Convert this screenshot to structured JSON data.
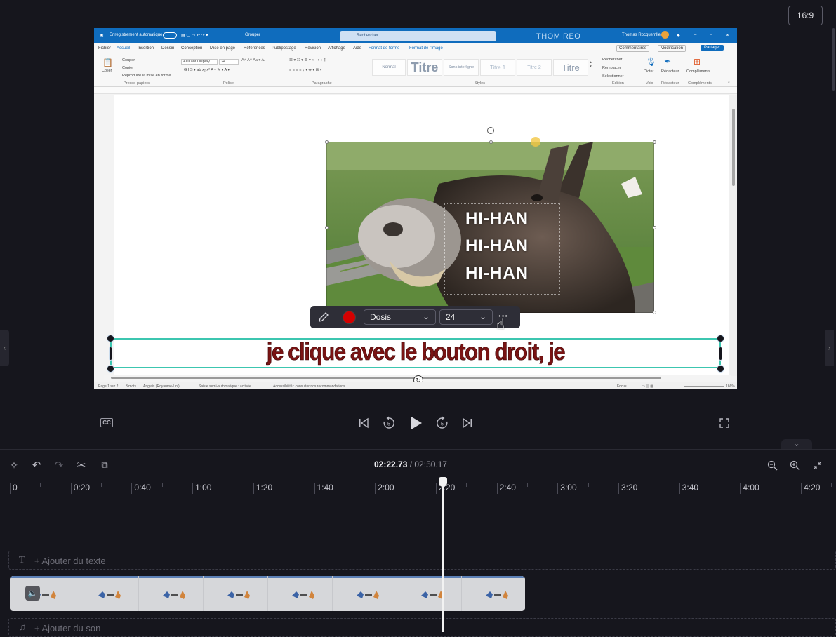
{
  "aspect_ratio": "16:9",
  "word_window": {
    "titlebar": {
      "autosave": "Enregistrement automatique",
      "group": "Grouper",
      "search_placeholder": "Rechercher",
      "watermark": "THOM REO",
      "user": "Thomas Rocquemlle"
    },
    "menu": [
      "Fichier",
      "Accueil",
      "Insertion",
      "Dessin",
      "Conception",
      "Mise en page",
      "Références",
      "Publipostage",
      "Révision",
      "Affichage",
      "Aide",
      "Format de forme",
      "Format de l'image"
    ],
    "menu_right": {
      "comments": "Commentaires",
      "modification": "Modification",
      "share": "Partager"
    },
    "ribbon": {
      "paste": "Coller",
      "cut": "Couper",
      "copy": "Copier",
      "format_painter": "Reproduire la mise en forme",
      "clipboard_group": "Presse-papiers",
      "font_name": "ADLaM Display",
      "font_size": "24",
      "font_group": "Police",
      "paragraph_group": "Paragraphe",
      "styles": [
        "Normal",
        "Titre",
        "Sans interligne",
        "Titre 1",
        "Titre 2",
        "Titre"
      ],
      "styles_group": "Styles",
      "find": "Rechercher",
      "replace": "Remplacer",
      "select": "Sélectionner",
      "edit_group": "Édition",
      "dictate": "Dicter",
      "voice_group": "Voix",
      "editor": "Rédacteur",
      "editor_group": "Rédacteur",
      "addins": "Compléments",
      "addins_group": "Compléments"
    },
    "image_text": [
      "HI-HAN",
      "HI-HAN",
      "HI-HAN"
    ],
    "statusbar": {
      "page": "Page 1 sur 2",
      "words": "3 mots",
      "language": "Anglais (Royaume-Uni)",
      "prediction": "Saisie semi-automatique : activée",
      "accessibility": "Accessibilité : consulter nos recommandations",
      "focus": "Focus",
      "zoom": "166%"
    }
  },
  "text_toolbar": {
    "color": "#d40000",
    "font": "Dosis",
    "size": "24",
    "more": "···"
  },
  "caption": "je clique avec le bouton droit, je",
  "player": {
    "cc": "CC",
    "current_time": "02:22.73",
    "total_time": "/ 02:50.17"
  },
  "timeline": {
    "ruler": [
      "0",
      "0:20",
      "0:40",
      "1:00",
      "1:20",
      "1:40",
      "2:00",
      "2:20",
      "2:40",
      "3:00",
      "3:20",
      "3:40",
      "4:00",
      "4:20"
    ],
    "add_text": "+ Ajouter du texte",
    "add_audio": "+ Ajouter du son"
  }
}
